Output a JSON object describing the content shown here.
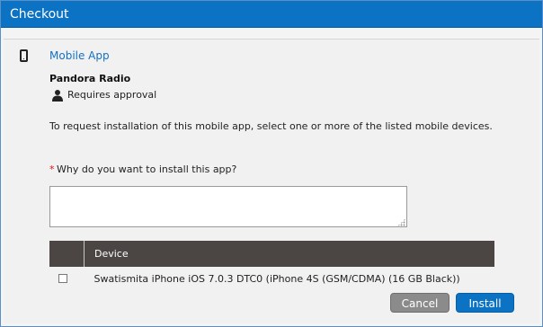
{
  "dialog": {
    "title": "Checkout"
  },
  "app": {
    "type_label": "Mobile App",
    "name": "Pandora Radio",
    "approval_text": "Requires approval"
  },
  "instructions": "To request installation of this mobile app, select one or more of the listed mobile devices.",
  "reason": {
    "required_marker": "*",
    "label": "Why do you want to install this app?",
    "value": ""
  },
  "devices_table": {
    "columns": [
      "",
      "Device"
    ],
    "rows": [
      {
        "checked": false,
        "device": "Swatismita iPhone iOS 7.0.3 DTC0 (iPhone 4S (GSM/CDMA) (16 GB Black))"
      }
    ]
  },
  "buttons": {
    "cancel": "Cancel",
    "install": "Install"
  },
  "colors": {
    "title_bar": "#0b72c4",
    "link_blue": "#1470c3",
    "table_header": "#4b4644",
    "cancel_button": "#8b8b8b",
    "install_button": "#0b72c4",
    "required_star": "#d11111"
  },
  "icons": {
    "device": "mobile-phone-icon",
    "approval": "user-icon"
  }
}
